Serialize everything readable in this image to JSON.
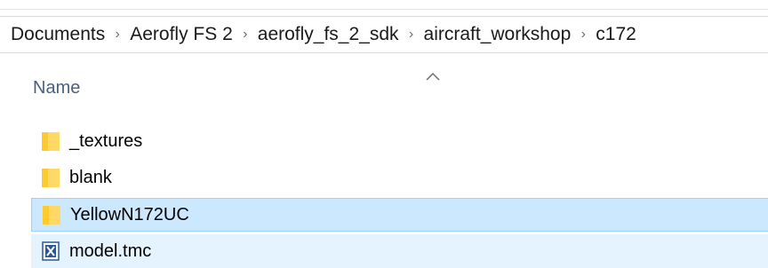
{
  "breadcrumb": {
    "items": [
      "Documents",
      "Aerofly FS 2",
      "aerofly_fs_2_sdk",
      "aircraft_workshop",
      "c172"
    ],
    "separator": "›"
  },
  "column": {
    "name_header": "Name",
    "sort": "ascending"
  },
  "files": [
    {
      "name": "_textures",
      "type": "folder",
      "state": "normal"
    },
    {
      "name": "blank",
      "type": "folder",
      "state": "normal"
    },
    {
      "name": "YellowN172UC",
      "type": "folder",
      "state": "selected"
    },
    {
      "name": "model.tmc",
      "type": "file",
      "state": "hover"
    }
  ],
  "colors": {
    "folder_body": "#ffd866",
    "folder_tab": "#ffca2c",
    "selected_bg": "#cce8ff",
    "selected_border": "#99d1ff",
    "hover_bg": "#e5f3ff",
    "header_text": "#4c607a"
  },
  "icons": {
    "folder": "folder-icon",
    "file": "tmc-file-icon",
    "sort": "sort-ascending-icon"
  }
}
